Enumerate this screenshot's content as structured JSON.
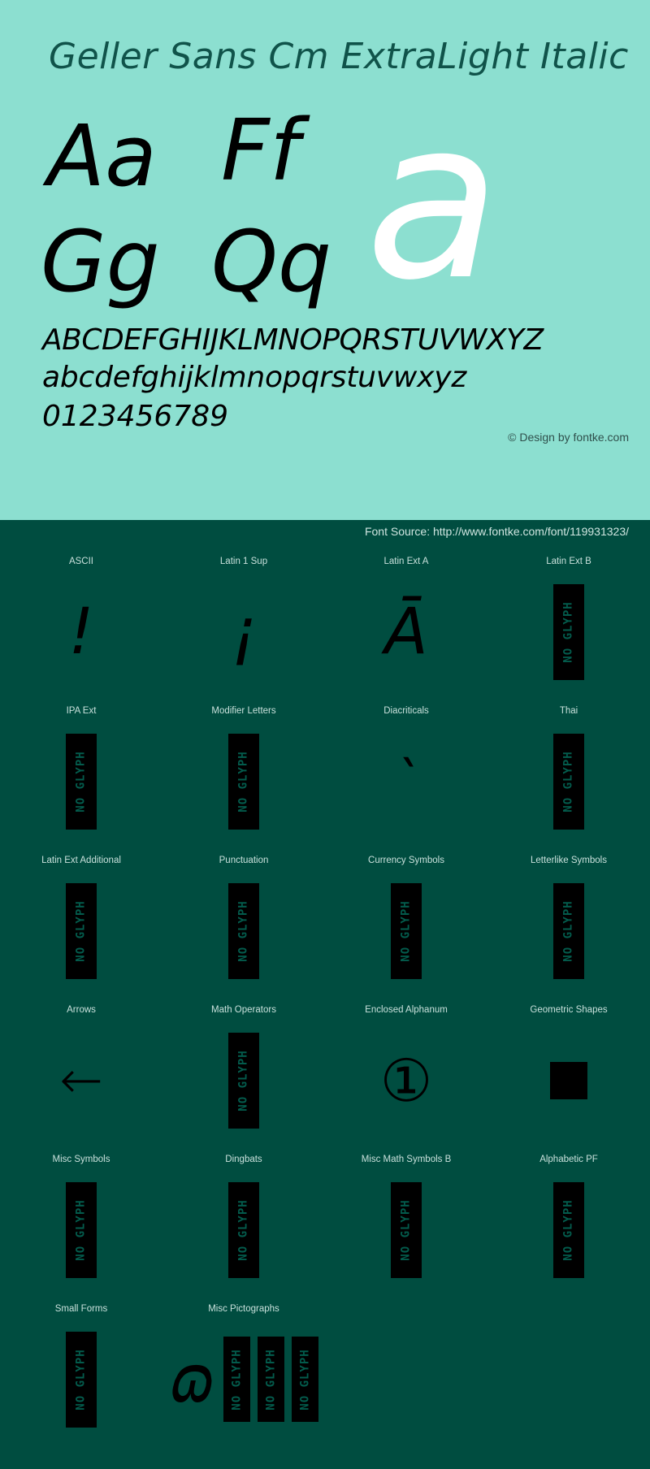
{
  "specimen": {
    "title": "Geller Sans Cm ExtraLight Italic",
    "background_color": "#8cdfd0",
    "text_color": "#10534a",
    "glyph_pairs": [
      "Aa",
      "Ff",
      "Gg",
      "Qq"
    ],
    "feature_glyph": "a",
    "feature_glyph_color": "#ffffff",
    "alphabet_upper": "ABCDEFGHIJKLMNOPQRSTUVWXYZ",
    "alphabet_lower": "abcdefghijklmnopqrstuvwxyz",
    "digits": "0123456789",
    "credit": "© Design by fontke.com"
  },
  "source": {
    "text": "Font Source: http://www.fontke.com/font/119931323/",
    "background_color": "#004d40",
    "text_color": "#cfe5e0"
  },
  "no_glyph_label": "NO GLYPH",
  "blocks": [
    [
      {
        "label": "ASCII",
        "sample": "!",
        "kind": "char"
      },
      {
        "label": "Latin 1 Sup",
        "sample": "¡",
        "kind": "char"
      },
      {
        "label": "Latin Ext A",
        "sample": "Ā",
        "kind": "char"
      },
      {
        "label": "Latin Ext B",
        "sample": "",
        "kind": "noglyph"
      }
    ],
    [
      {
        "label": "IPA Ext",
        "sample": "",
        "kind": "noglyph"
      },
      {
        "label": "Modifier Letters",
        "sample": "",
        "kind": "noglyph"
      },
      {
        "label": "Diacriticals",
        "sample": "̀",
        "kind": "char"
      },
      {
        "label": "Thai",
        "sample": "",
        "kind": "noglyph"
      }
    ],
    [
      {
        "label": "Latin Ext Additional",
        "sample": "",
        "kind": "noglyph"
      },
      {
        "label": "Punctuation",
        "sample": "",
        "kind": "noglyph"
      },
      {
        "label": "Currency Symbols",
        "sample": "",
        "kind": "noglyph"
      },
      {
        "label": "Letterlike Symbols",
        "sample": "",
        "kind": "noglyph"
      }
    ],
    [
      {
        "label": "Arrows",
        "sample": "←",
        "kind": "arrow"
      },
      {
        "label": "Math Operators",
        "sample": "",
        "kind": "noglyph"
      },
      {
        "label": "Enclosed Alphanum",
        "sample": "①",
        "kind": "circled"
      },
      {
        "label": "Geometric Shapes",
        "sample": "",
        "kind": "square"
      }
    ],
    [
      {
        "label": "Misc Symbols",
        "sample": "",
        "kind": "noglyph"
      },
      {
        "label": "Dingbats",
        "sample": "",
        "kind": "noglyph"
      },
      {
        "label": "Misc Math Symbols B",
        "sample": "",
        "kind": "noglyph"
      },
      {
        "label": "Alphabetic PF",
        "sample": "",
        "kind": "noglyph"
      }
    ],
    [
      {
        "label": "Small Forms",
        "sample": "",
        "kind": "noglyph"
      },
      {
        "label": "Misc Pictographs",
        "sample": "ɷ",
        "kind": "cluster"
      },
      {
        "label": "",
        "kind": "empty"
      },
      {
        "label": "",
        "kind": "empty"
      }
    ]
  ]
}
